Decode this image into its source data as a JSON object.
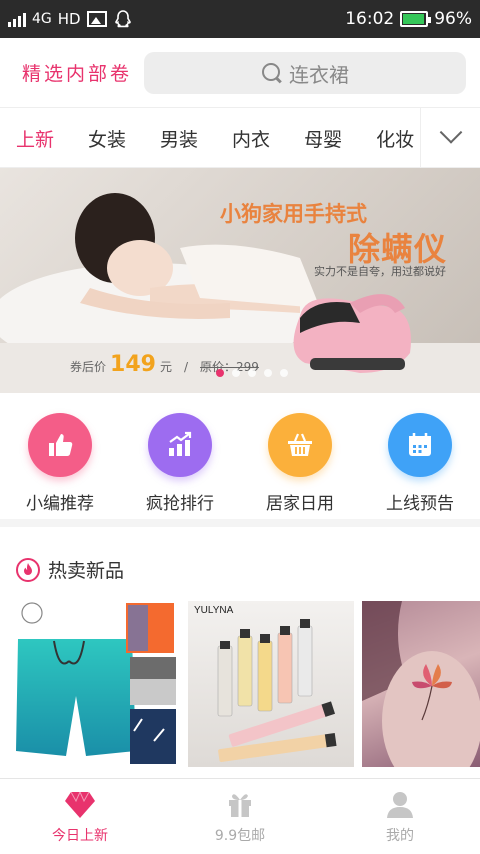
{
  "status_bar": {
    "network": "4G",
    "hd": "HD",
    "time": "16:02",
    "battery": "96%",
    "battery_level": 0.96
  },
  "header": {
    "brand": "精选内部卷",
    "search_placeholder": "连衣裙"
  },
  "tabs": [
    "上新",
    "女装",
    "男装",
    "内衣",
    "母婴",
    "化妆"
  ],
  "active_tab_index": 0,
  "banner": {
    "title": "小狗家用手持式",
    "product": "除螨仪",
    "slogan": "实力不是自夸，用过都说好",
    "price_prefix": "券后价",
    "price": "149",
    "price_unit": "元",
    "separator": "/",
    "original_price": "原价：299",
    "slide_count": 5,
    "active_slide": 0
  },
  "quick_menu": [
    {
      "label": "小编推荐",
      "icon": "thumbs-up-icon",
      "color": "#f45d88"
    },
    {
      "label": "疯抢排行",
      "icon": "chart-up-icon",
      "color": "#9d6cf0"
    },
    {
      "label": "居家日用",
      "icon": "basket-icon",
      "color": "#fbb03b"
    },
    {
      "label": "上线预告",
      "icon": "calendar-icon",
      "color": "#3fa2f7"
    }
  ],
  "hot_section": {
    "title": "热卖新品",
    "icon": "flame-icon",
    "product_brand_2": "YULYNA"
  },
  "bottom_nav": [
    {
      "label": "今日上新",
      "icon": "heart-icon",
      "active": true
    },
    {
      "label": "9.9包邮",
      "icon": "gift-icon",
      "active": false
    },
    {
      "label": "我的",
      "icon": "user-icon",
      "active": false
    }
  ],
  "colors": {
    "accent": "#e8336d",
    "price": "#f2a31d",
    "banner_text": "#e9833f"
  }
}
